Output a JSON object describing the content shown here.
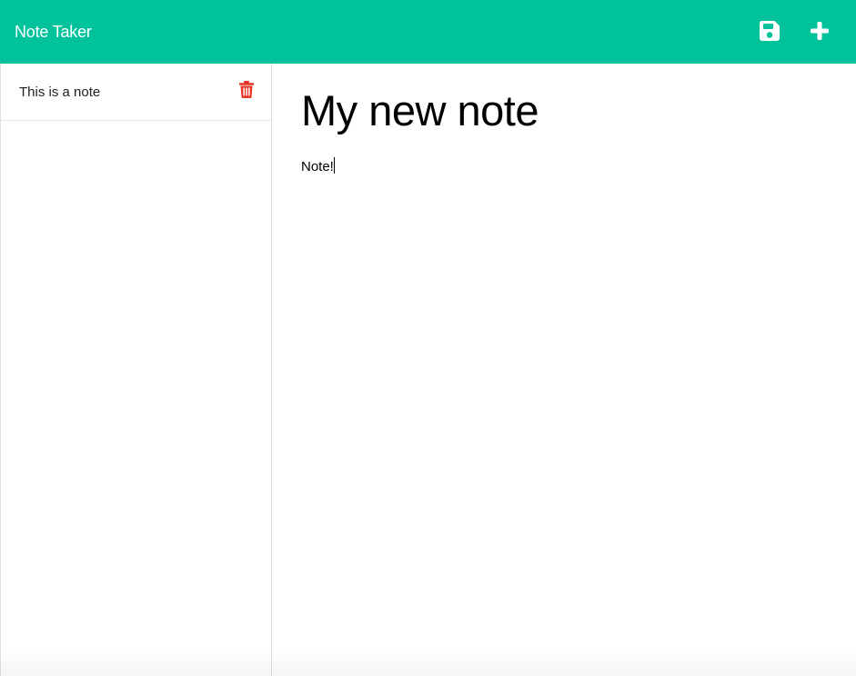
{
  "navbar": {
    "brand": "Note Taker",
    "icons": {
      "save": "save-icon",
      "new": "plus-icon"
    },
    "icon_color": "#ffffff",
    "background": "#00c29b"
  },
  "sidebar": {
    "notes": [
      {
        "title": "This is a note",
        "delete_icon": "trash-icon",
        "delete_color": "#e8372a"
      }
    ]
  },
  "editor": {
    "title": "My new note",
    "body": "Note!"
  }
}
